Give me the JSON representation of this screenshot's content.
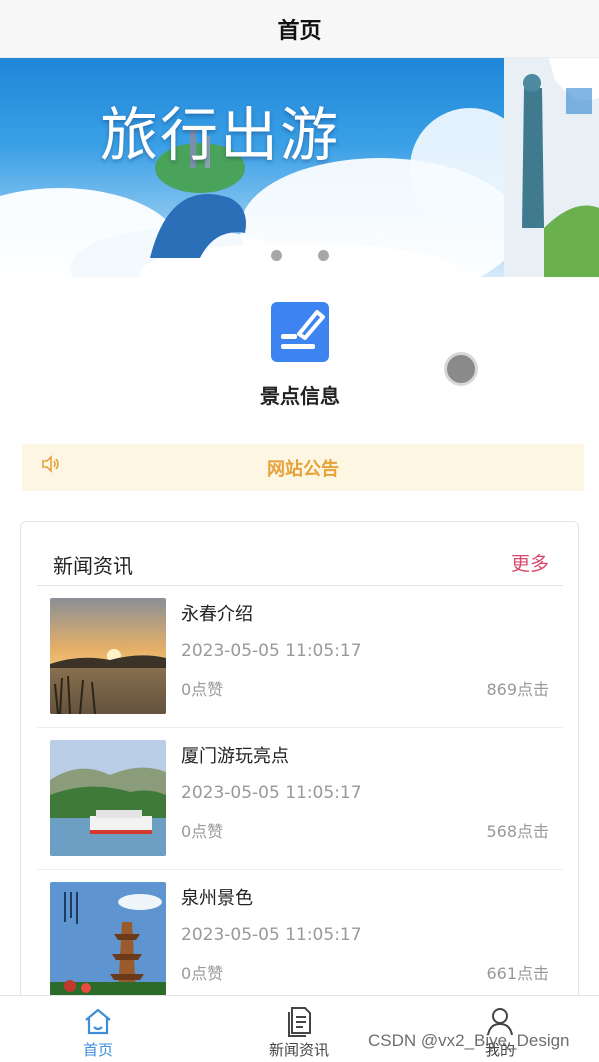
{
  "header": {
    "title": "首页"
  },
  "banner": {
    "slide1_title": "旅行出游",
    "slides": [
      "slide-1",
      "slide-2"
    ],
    "active_index": 0
  },
  "feature": {
    "label": "景点信息",
    "icon": "edit-note-icon"
  },
  "notice": {
    "label": "网站公告",
    "icon": "speaker-icon"
  },
  "news": {
    "title": "新闻资讯",
    "more_label": "更多",
    "items": [
      {
        "name": "永春介绍",
        "time": "2023-05-05 11:05:17",
        "likes": "0点赞",
        "clicks": "869点击"
      },
      {
        "name": "厦门游玩亮点",
        "time": "2023-05-05 11:05:17",
        "likes": "0点赞",
        "clicks": "568点击"
      },
      {
        "name": "泉州景色",
        "time": "2023-05-05 11:05:17",
        "likes": "0点赞",
        "clicks": "661点击"
      }
    ]
  },
  "tabbar": {
    "tabs": [
      {
        "label": "首页",
        "icon": "home-icon",
        "active": true
      },
      {
        "label": "新闻资讯",
        "icon": "document-icon",
        "active": false
      },
      {
        "label": "我的",
        "icon": "user-icon",
        "active": false
      }
    ]
  },
  "watermark": "CSDN @vx2_Biye_Design",
  "colors": {
    "accent": "#3d8ed8",
    "more": "#d9486b",
    "notice": "#e6a23c",
    "feature_icon": "#3d84f0"
  }
}
